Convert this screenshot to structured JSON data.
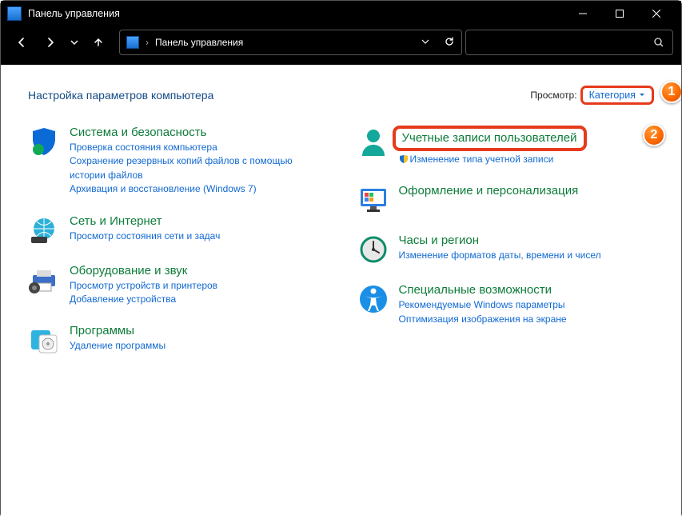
{
  "window": {
    "title": "Панель управления"
  },
  "breadcrumb": {
    "label": "Панель управления",
    "sep": "›"
  },
  "heading": "Настройка параметров компьютера",
  "view_by": {
    "label": "Просмотр:",
    "value": "Категория"
  },
  "markers": {
    "one": "1",
    "two": "2"
  },
  "cats": {
    "system": {
      "title": "Система и безопасность",
      "sub1": "Проверка состояния компьютера",
      "sub2": "Сохранение резервных копий файлов с помощью истории файлов",
      "sub3": "Архивация и восстановление (Windows 7)"
    },
    "network": {
      "title": "Сеть и Интернет",
      "sub1": "Просмотр состояния сети и задач"
    },
    "hardware": {
      "title": "Оборудование и звук",
      "sub1": "Просмотр устройств и принтеров",
      "sub2": "Добавление устройства"
    },
    "programs": {
      "title": "Программы",
      "sub1": "Удаление программы"
    },
    "accounts": {
      "title": "Учетные записи пользователей",
      "sub1": "Изменение типа учетной записи"
    },
    "appearance": {
      "title": "Оформление и персонализация"
    },
    "clock": {
      "title": "Часы и регион",
      "sub1": "Изменение форматов даты, времени и чисел"
    },
    "ease": {
      "title": "Специальные возможности",
      "sub1": "Рекомендуемые Windows параметры",
      "sub2": "Оптимизация изображения на экране"
    }
  }
}
